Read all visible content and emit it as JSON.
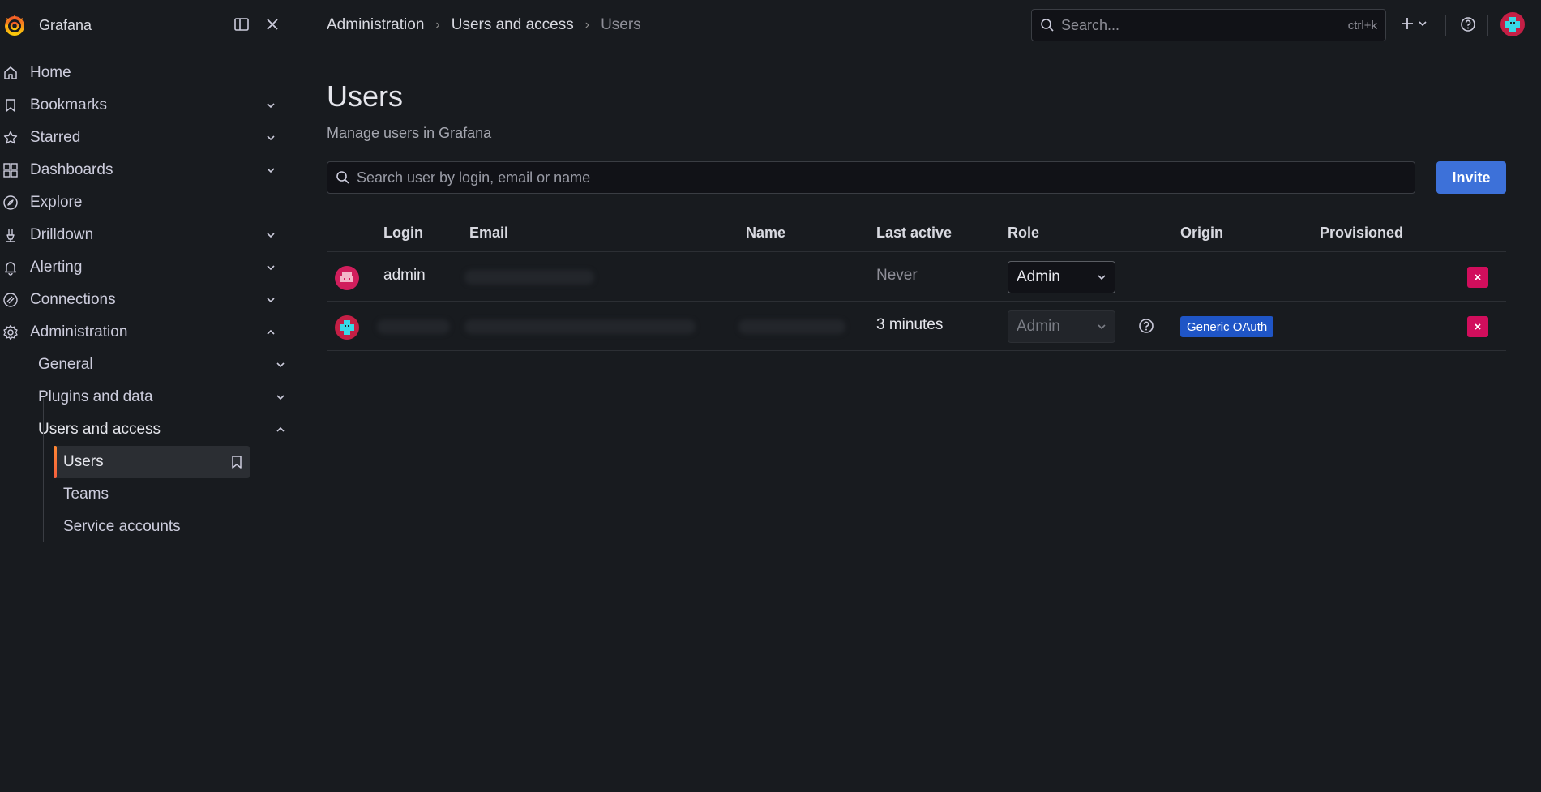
{
  "app": {
    "name": "Grafana"
  },
  "topbar": {
    "breadcrumb": [
      "Administration",
      "Users and access",
      "Users"
    ],
    "search_placeholder": "Search...",
    "search_shortcut": "ctrl+k"
  },
  "sidebar": {
    "items": [
      {
        "label": "Home",
        "icon": "home-icon"
      },
      {
        "label": "Bookmarks",
        "icon": "bookmark-icon",
        "expandable": true
      },
      {
        "label": "Starred",
        "icon": "star-icon",
        "expandable": true
      },
      {
        "label": "Dashboards",
        "icon": "dashboards-icon",
        "expandable": true
      },
      {
        "label": "Explore",
        "icon": "compass-icon"
      },
      {
        "label": "Drilldown",
        "icon": "drilldown-icon",
        "expandable": true
      },
      {
        "label": "Alerting",
        "icon": "bell-icon",
        "expandable": true
      },
      {
        "label": "Connections",
        "icon": "connections-icon",
        "expandable": true
      },
      {
        "label": "Administration",
        "icon": "gear-icon",
        "expandable": true,
        "expanded": true
      }
    ],
    "admin_children": [
      {
        "label": "General"
      },
      {
        "label": "Plugins and data"
      },
      {
        "label": "Users and access"
      }
    ],
    "users_access_children": [
      {
        "label": "Users",
        "active": true
      },
      {
        "label": "Teams"
      },
      {
        "label": "Service accounts"
      }
    ]
  },
  "main": {
    "title": "Users",
    "subtitle": "Manage users in Grafana",
    "search_placeholder": "Search user by login, email or name",
    "invite_label": "Invite",
    "columns": [
      "Login",
      "Email",
      "Name",
      "Last active",
      "Role",
      "Origin",
      "Provisioned"
    ],
    "rows": [
      {
        "login": "admin",
        "last_active": "Never",
        "role": "Admin",
        "role_editable": true,
        "origin": "",
        "avatar_color": "#d11e5c"
      },
      {
        "login": "",
        "last_active": "3 minutes",
        "role": "Admin",
        "role_editable": false,
        "origin": "Generic OAuth",
        "avatar_color": "#c41f45"
      }
    ]
  },
  "colors": {
    "background": "#181b1f",
    "primary": "#3d71d9",
    "danger": "#d10e5c",
    "active_accent": "#f55f3e",
    "badge_blue": "#1f55c6"
  }
}
